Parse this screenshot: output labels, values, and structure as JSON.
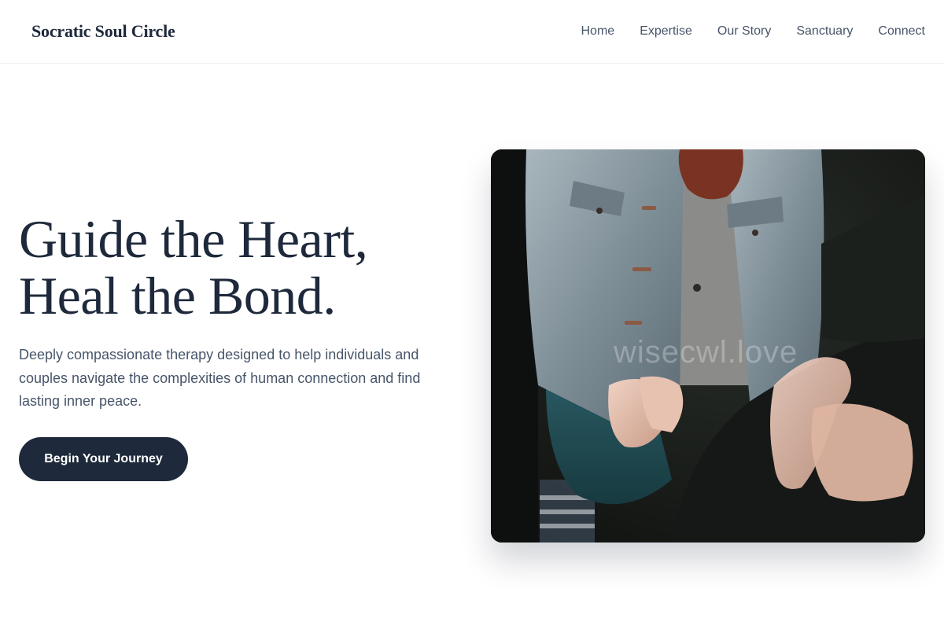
{
  "header": {
    "brand": "Socratic Soul Circle",
    "nav": [
      "Home",
      "Expertise",
      "Our Story",
      "Sanctuary",
      "Connect"
    ]
  },
  "hero": {
    "title_line1": "Guide the Heart,",
    "title_line2": "Heal the Bond.",
    "subtitle": "Deeply compassionate therapy designed to help individuals and couples navigate the complexities of human connection and find lasting inner peace.",
    "cta_label": "Begin Your Journey"
  },
  "image": {
    "description_icon": "photo-two-people-hands-clasped",
    "watermark": "wisecwl.love"
  },
  "colors": {
    "primary": "#1e293b",
    "text_muted": "#475569",
    "background": "#ffffff"
  }
}
